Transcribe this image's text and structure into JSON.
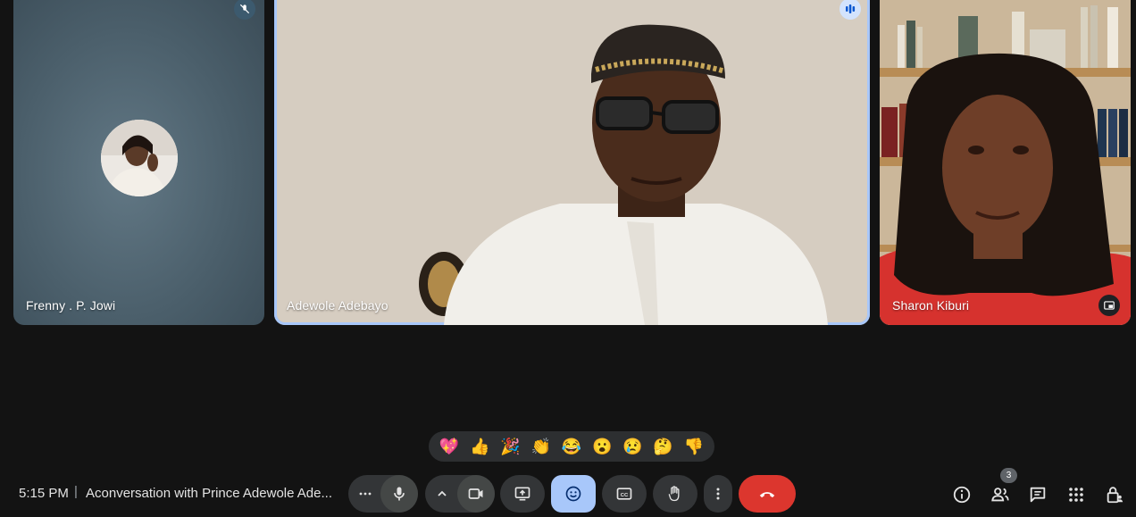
{
  "participants": [
    {
      "name": "Frenny . P. Jowi",
      "muted": true
    },
    {
      "name": "Adewole Adebayo",
      "speaking": true
    },
    {
      "name": "Sharon Kiburi"
    }
  ],
  "reactions": [
    "💖",
    "👍",
    "🎉",
    "👏",
    "😂",
    "😮",
    "😢",
    "🤔",
    "👎"
  ],
  "footer": {
    "time": "5:15 PM",
    "separator": "|",
    "meeting_title": "Aconversation with Prince Adewole Ade..."
  },
  "people_count": "3",
  "colors": {
    "background": "#131313",
    "active_speaker_border": "#a8c7fa",
    "end_call": "#dc362e",
    "reactions_active": "#a8c7fa"
  }
}
